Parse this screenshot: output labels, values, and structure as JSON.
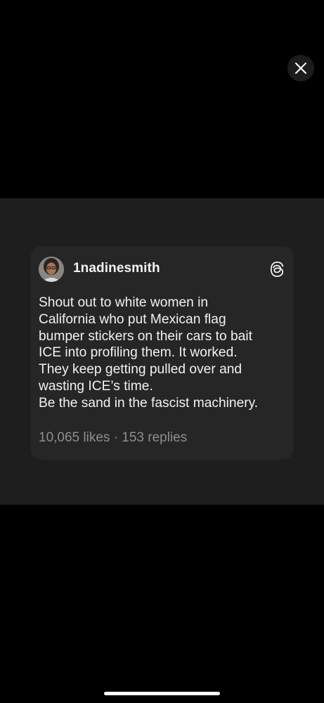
{
  "viewer": {
    "close_icon": "close-icon"
  },
  "post": {
    "username": "1nadinesmith",
    "platform_icon": "threads-icon",
    "lines": [
      "Shout out to white women in",
      "California who put Mexican flag",
      "bumper stickers on their cars to bait",
      "ICE into profiling them. It worked.",
      "They keep getting pulled over and",
      "wasting ICE’s time.",
      "Be the sand in the fascist machinery."
    ],
    "likes": "10,065 likes",
    "separator": "·",
    "replies": "153 replies"
  },
  "colors": {
    "background": "#000000",
    "image_area": "#1e1e1e",
    "card": "#262626",
    "text": "#f2f2f2",
    "muted_text": "#8e8e8e",
    "close_button_bg": "#1c1c1e"
  }
}
